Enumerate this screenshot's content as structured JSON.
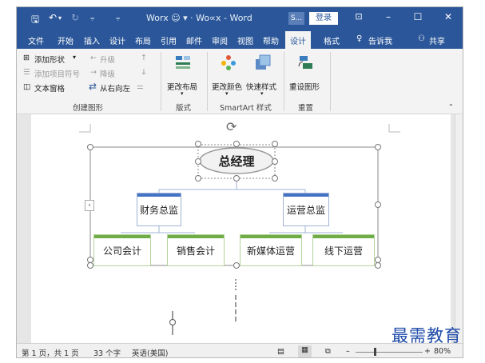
{
  "titlebar": {
    "title": "Worx ☺ ▾ · Wo∝x - Word",
    "s_button": "S...",
    "login": "登录"
  },
  "tabs": [
    "文件",
    "开始",
    "插入",
    "设计",
    "布局",
    "引用",
    "邮件",
    "审阅",
    "视图",
    "帮助",
    "设计",
    "格式"
  ],
  "tell_me": "告诉我",
  "share": "共享",
  "ribbon": {
    "create": {
      "add_shape": "添加形状",
      "add_bullet": "添加项目符号",
      "text_pane": "文本窗格",
      "promote": "升级",
      "demote": "降级",
      "rtl": "从右向左",
      "group": "创建图形"
    },
    "layouts": {
      "change_layout": "更改布局",
      "group": "版式"
    },
    "styles": {
      "change_colors": "更改颜色",
      "quick_styles": "快速样式",
      "group": "SmartArt 样式"
    },
    "reset": {
      "reset_graphic": "重设图形",
      "group": "重置"
    }
  },
  "org": {
    "ceo": "总经理",
    "managers": [
      "财务总监",
      "运营总监"
    ],
    "staff": [
      "公司会计",
      "销售会计",
      "新媒体运营",
      "线下运营"
    ]
  },
  "status": {
    "page": "第 1 页，共 1 页",
    "words": "33 个字",
    "lang": "英语(美国)",
    "zoom": "80%"
  },
  "watermark": "最需教育",
  "colors": {
    "accent": "#2b579a",
    "manager": "#4472c4",
    "staff": "#70ad47"
  }
}
